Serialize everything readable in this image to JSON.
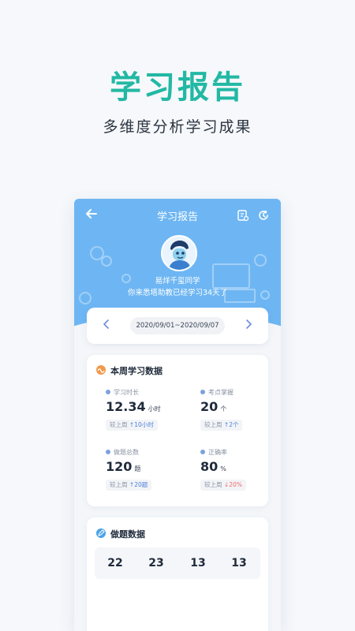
{
  "promo": {
    "title": "学习报告",
    "subtitle": "多维度分析学习成果"
  },
  "header": {
    "title": "学习报告",
    "back_icon": "back-arrow-icon",
    "icons": [
      "report-icon",
      "history-icon"
    ]
  },
  "user": {
    "name": "易烊千玺同学",
    "note": "你来悉塔助教已经学习34天了"
  },
  "date_range": {
    "label": "2020/09/01~2020/09/07",
    "prev_icon": "chevron-left-icon",
    "next_icon": "chevron-right-icon"
  },
  "weekly": {
    "title": "本周学习数据",
    "stats": [
      {
        "label": "学习时长",
        "value": "12.34",
        "unit": "小时",
        "compare_prefix": "较上周",
        "compare_arrow": "↑",
        "compare_value": "10小时"
      },
      {
        "label": "考点掌握",
        "value": "20",
        "unit": "个",
        "compare_prefix": "较上周",
        "compare_arrow": "↑",
        "compare_value": "2个"
      },
      {
        "label": "做题总数",
        "value": "120",
        "unit": "题",
        "compare_prefix": "较上周",
        "compare_arrow": "↑",
        "compare_value": "20题"
      },
      {
        "label": "正确率",
        "value": "80",
        "unit": "%",
        "compare_prefix": "较上周",
        "compare_arrow": "↓",
        "compare_value": "20%"
      }
    ]
  },
  "practice": {
    "title": "做题数据",
    "numbers": [
      "22",
      "23",
      "13",
      "13"
    ]
  },
  "colors": {
    "accent": "#22b8a4",
    "header_blue": "#6eb6f3",
    "up": "#4b7fd9",
    "down": "#ee6d6d"
  }
}
